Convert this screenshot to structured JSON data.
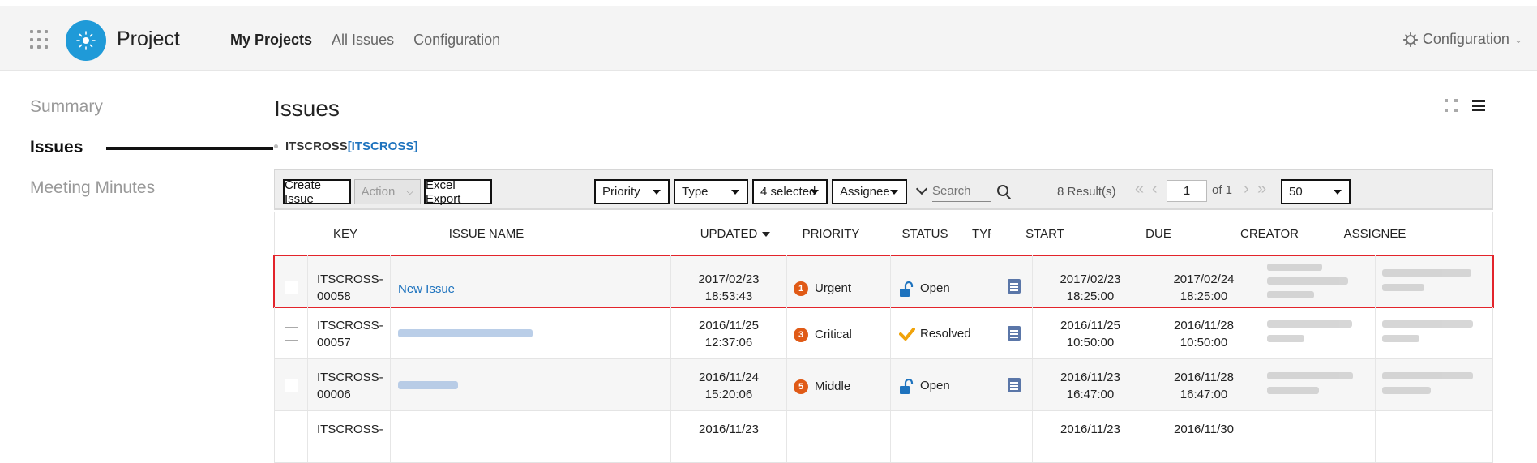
{
  "header": {
    "app_title": "Project",
    "nav": [
      "My Projects",
      "All Issues",
      "Configuration"
    ],
    "config_label": "Configuration"
  },
  "sidebar": {
    "items": [
      "Summary",
      "Issues",
      "Meeting Minutes"
    ]
  },
  "main": {
    "title": "Issues",
    "breadcrumb": {
      "key": "ITSCROSS",
      "link": "[ITSCROSS]"
    }
  },
  "toolbar": {
    "create_label": "Create Issue",
    "action_label": "Action",
    "export_label": "Excel Export",
    "filters": [
      "Priority",
      "Type",
      "4 selected",
      "Assignee"
    ],
    "search_placeholder": "Search",
    "results": "8 Result(s)",
    "page": "1",
    "of_pages": "of 1",
    "page_size": "50"
  },
  "table": {
    "columns": [
      "KEY",
      "ISSUE NAME",
      "UPDATED",
      "PRIORITY",
      "STATUS",
      "TYPE",
      "START",
      "DUE",
      "CREATOR",
      "ASSIGNEE"
    ],
    "rows": [
      {
        "key": "ITSCROSS-00058",
        "name": "New Issue",
        "updated": [
          "2017/02/23",
          "18:53:43"
        ],
        "priority_num": "1",
        "priority": "Urgent",
        "status": "Open",
        "start": [
          "2017/02/23",
          "18:25:00"
        ],
        "due": [
          "2017/02/24",
          "18:25:00"
        ],
        "creator": "",
        "assignee": ""
      },
      {
        "key": "ITSCROSS-00057",
        "name": "",
        "updated": [
          "2016/11/25",
          "12:37:06"
        ],
        "priority_num": "3",
        "priority": "Critical",
        "status": "Resolved",
        "start": [
          "2016/11/25",
          "10:50:00"
        ],
        "due": [
          "2016/11/28",
          "10:50:00"
        ],
        "creator": "",
        "assignee": ""
      },
      {
        "key": "ITSCROSS-00006",
        "name": "",
        "updated": [
          "2016/11/24",
          "15:20:06"
        ],
        "priority_num": "5",
        "priority": "Middle",
        "status": "Open",
        "start": [
          "2016/11/23",
          "16:47:00"
        ],
        "due": [
          "2016/11/28",
          "16:47:00"
        ],
        "creator": "",
        "assignee": ""
      },
      {
        "key": "ITSCROSS-",
        "name": "",
        "updated": [
          "2016/11/23",
          ""
        ],
        "priority_num": "",
        "priority": "",
        "status": "",
        "start": [
          "2016/11/23",
          ""
        ],
        "due": [
          "2016/11/30",
          ""
        ],
        "creator": "",
        "assignee": ""
      }
    ]
  },
  "colors": {
    "accent": "#1f9ad8",
    "link": "#1e73be",
    "priority": "#e05a16",
    "selection": "#e3242b",
    "type_icon": "#5a76a8"
  }
}
